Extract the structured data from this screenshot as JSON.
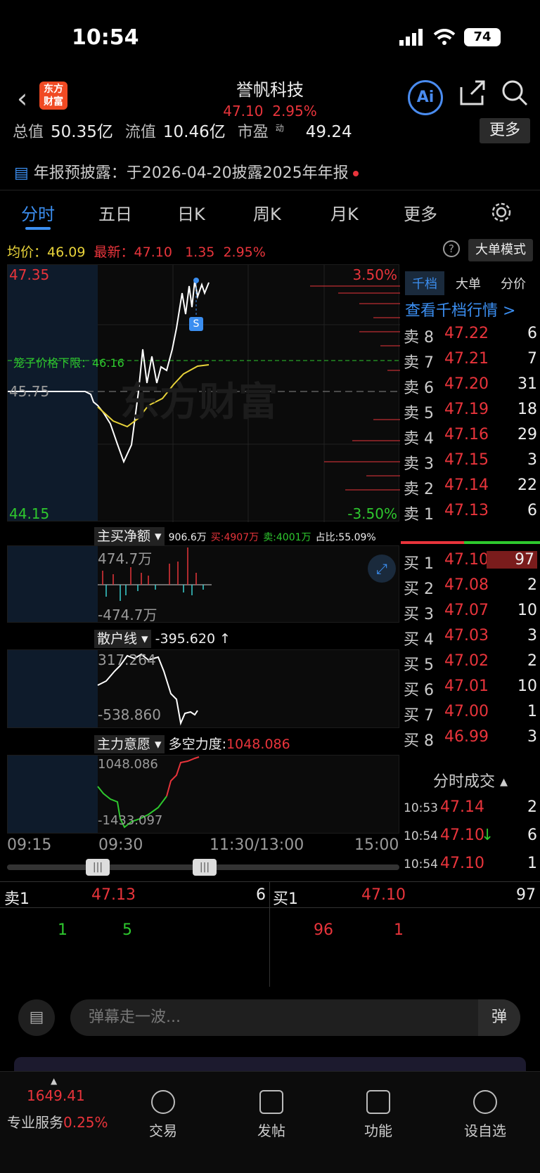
{
  "status": {
    "time": "10:54",
    "battery": "74"
  },
  "header": {
    "logo_line1": "东方",
    "logo_line2": "财富",
    "name": "誉帆科技",
    "price": "47.10",
    "change_pct": "2.95%",
    "ai_label": "Ai"
  },
  "metrics": {
    "total_cap_label": "总值",
    "total_cap": "50.35亿",
    "float_label": "流值",
    "float_cap": "10.46亿",
    "pe_label": "市盈",
    "pe_sup": "动",
    "pe": "49.24",
    "more": "更多"
  },
  "notice": {
    "text": "年报预披露：于2026-04-20披露2025年年报"
  },
  "tabs": [
    {
      "label": "分时"
    },
    {
      "label": "五日"
    },
    {
      "label": "日K"
    },
    {
      "label": "周K"
    },
    {
      "label": "月K"
    },
    {
      "label": "更多"
    }
  ],
  "price_row": {
    "avg_label": "均价：",
    "avg": "46.09",
    "last_label": "最新：",
    "last": "47.10",
    "chg": "1.35",
    "chg_pct": "2.95%",
    "mode_btn": "大单模式"
  },
  "main_chart": {
    "y_top": "47.35",
    "y_mid": "45.75",
    "y_bottom": "44.15",
    "pct_top": "3.50%",
    "pct_bottom": "-3.50%",
    "cage_label": "笼子价格下限：46.16",
    "s_marker": "S",
    "watermark": "东方财富"
  },
  "indicator1": {
    "name": "主买净额",
    "value": "906.6万",
    "buy": "买:4907万",
    "sell": "卖:4001万",
    "ratio": "占比:55.09%",
    "top": "474.7万",
    "bottom": "-474.7万"
  },
  "indicator2": {
    "name": "散户线",
    "value": "-395.620 ↑",
    "top": "317.264",
    "bottom": "-538.860"
  },
  "indicator3": {
    "name": "主力意愿",
    "value_label": "多空力度:",
    "value": "1048.086",
    "top": "1048.086",
    "bottom": "-1433.097"
  },
  "time_axis": [
    "09:15",
    "09:30",
    "11:30/13:00",
    "15:00"
  ],
  "orderbook": {
    "tabs": [
      "千档",
      "大单",
      "分价"
    ],
    "link": "查看千档行情 >",
    "asks": [
      {
        "label": "卖 8",
        "price": "47.22",
        "vol": "6"
      },
      {
        "label": "卖 7",
        "price": "47.21",
        "vol": "7"
      },
      {
        "label": "卖 6",
        "price": "47.20",
        "vol": "31"
      },
      {
        "label": "卖 5",
        "price": "47.19",
        "vol": "18"
      },
      {
        "label": "卖 4",
        "price": "47.16",
        "vol": "29"
      },
      {
        "label": "卖 3",
        "price": "47.15",
        "vol": "3"
      },
      {
        "label": "卖 2",
        "price": "47.14",
        "vol": "22"
      },
      {
        "label": "卖 1",
        "price": "47.13",
        "vol": "6"
      }
    ],
    "bids": [
      {
        "label": "买 1",
        "price": "47.10",
        "vol": "97"
      },
      {
        "label": "买 2",
        "price": "47.08",
        "vol": "2"
      },
      {
        "label": "买 3",
        "price": "47.07",
        "vol": "10"
      },
      {
        "label": "买 4",
        "price": "47.03",
        "vol": "3"
      },
      {
        "label": "买 5",
        "price": "47.02",
        "vol": "2"
      },
      {
        "label": "买 6",
        "price": "47.01",
        "vol": "10"
      },
      {
        "label": "买 7",
        "price": "47.00",
        "vol": "1"
      },
      {
        "label": "买 8",
        "price": "46.99",
        "vol": "3"
      }
    ],
    "trades_title": "分时成交",
    "trades": [
      {
        "time": "10:53",
        "price": "47.14",
        "vol": "2",
        "arrow": ""
      },
      {
        "time": "10:54",
        "price": "47.10",
        "vol": "6",
        "arrow": "↓"
      },
      {
        "time": "10:54",
        "price": "47.10",
        "vol": "1",
        "arrow": ""
      }
    ]
  },
  "summary": {
    "ask_label": "卖1",
    "ask_price": "47.13",
    "ask_vol": "6",
    "ask_splits": [
      "1",
      "5"
    ],
    "bid_label": "买1",
    "bid_price": "47.10",
    "bid_vol": "97",
    "bid_splits": [
      "96",
      "1"
    ]
  },
  "chat": {
    "placeholder": "弹幕走一波...",
    "send_icon": "弹"
  },
  "nav": {
    "index_value": "1649.41",
    "index_label": "专业服务",
    "index_pct": "0.25%",
    "items": [
      "交易",
      "发帖",
      "功能",
      "设自选"
    ]
  }
}
